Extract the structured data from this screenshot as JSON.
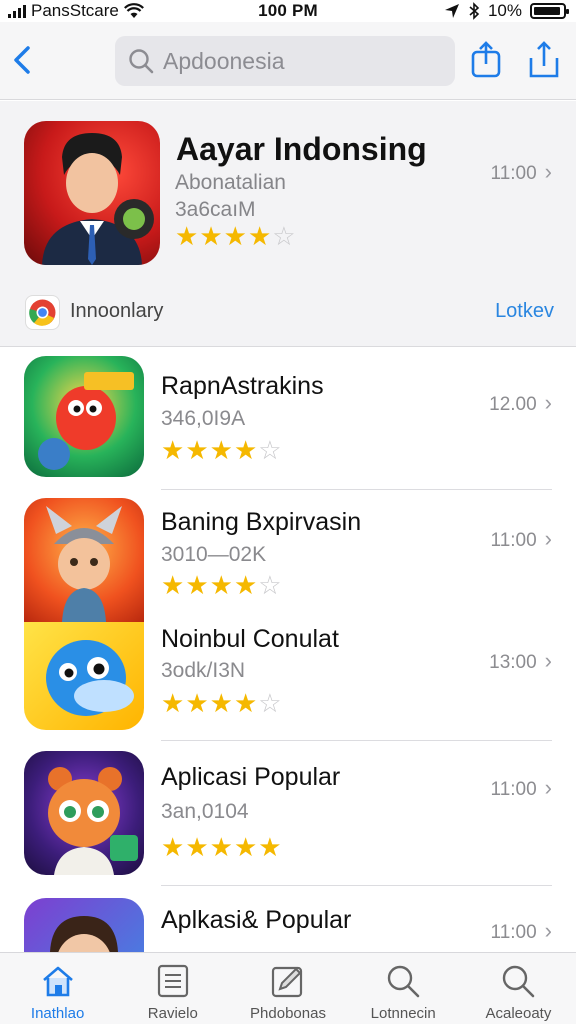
{
  "status_bar": {
    "carrier": "PansStcare",
    "time": "100 PM",
    "battery": "10%"
  },
  "search": {
    "placeholder": "Apdoonesia"
  },
  "featured": {
    "title": "Aayar Indonsing",
    "subtitle": "Abonatalian",
    "size": "3a6caıM",
    "rating": 4,
    "time": "11:00",
    "sub_label": "Innoonlary",
    "sub_link": "Lotkev"
  },
  "apps": [
    {
      "name": "RapnAstrakins",
      "meta": "346,0I9A",
      "rating": 4,
      "time": "12.00"
    },
    {
      "name": "Baning Bxpirvasin",
      "meta": "3010—02K",
      "rating": 4,
      "time": "11:00"
    },
    {
      "name": "Noinbul Conulat",
      "meta": "3odk/I3N",
      "rating": 4,
      "time": "13:00"
    },
    {
      "name": "Aplicasi Popular",
      "meta": "3an,0104",
      "rating": 5,
      "time": "11:00"
    },
    {
      "name": "Aplkasi& Popular",
      "meta": "",
      "rating": 0,
      "time": "11:00"
    }
  ],
  "tabs": [
    {
      "label": "Inathlao",
      "icon": "home-icon",
      "active": true
    },
    {
      "label": "Ravielo",
      "icon": "list-icon",
      "active": false
    },
    {
      "label": "Phdobonas",
      "icon": "edit-icon",
      "active": false
    },
    {
      "label": "Lotnnecin",
      "icon": "search-icon",
      "active": false
    },
    {
      "label": "Acaleoaty",
      "icon": "search-icon",
      "active": false
    }
  ],
  "colors": {
    "accent": "#1e7ce8",
    "star": "#f5b800",
    "link": "#2a86e0"
  }
}
